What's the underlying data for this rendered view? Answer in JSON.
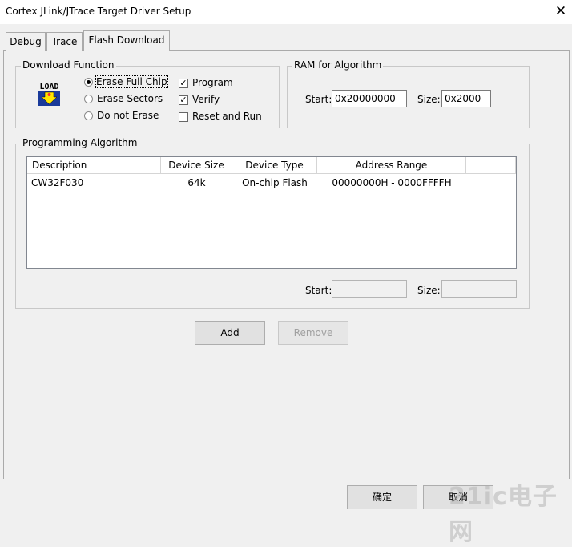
{
  "window": {
    "title": "Cortex JLink/JTrace Target Driver Setup",
    "close_glyph": "✕"
  },
  "tabs": [
    {
      "label": "Debug"
    },
    {
      "label": "Trace"
    },
    {
      "label": "Flash Download",
      "active": true
    }
  ],
  "download_function": {
    "legend": "Download Function",
    "icon_text": "LOAD",
    "radios": [
      {
        "label": "Erase Full Chip",
        "selected": true
      },
      {
        "label": "Erase Sectors",
        "selected": false
      },
      {
        "label": "Do not Erase",
        "selected": false
      }
    ],
    "checks": [
      {
        "label": "Program",
        "checked": true
      },
      {
        "label": "Verify",
        "checked": true
      },
      {
        "label": "Reset and Run",
        "checked": false
      }
    ]
  },
  "ram_for_algorithm": {
    "legend": "RAM for Algorithm",
    "start_label": "Start:",
    "start_value": "0x20000000",
    "size_label": "Size:",
    "size_value": "0x2000"
  },
  "programming_algorithm": {
    "legend": "Programming Algorithm",
    "columns": [
      "Description",
      "Device Size",
      "Device Type",
      "Address Range"
    ],
    "rows": [
      {
        "description": "CW32F030",
        "device_size": "64k",
        "device_type": "On-chip Flash",
        "address_range": "00000000H - 0000FFFFH"
      }
    ],
    "start_label": "Start:",
    "start_value": "",
    "size_label": "Size:",
    "size_value": ""
  },
  "buttons": {
    "add": "Add",
    "remove": "Remove",
    "ok": "确定",
    "cancel": "取消"
  },
  "watermark": "21ic电子网"
}
